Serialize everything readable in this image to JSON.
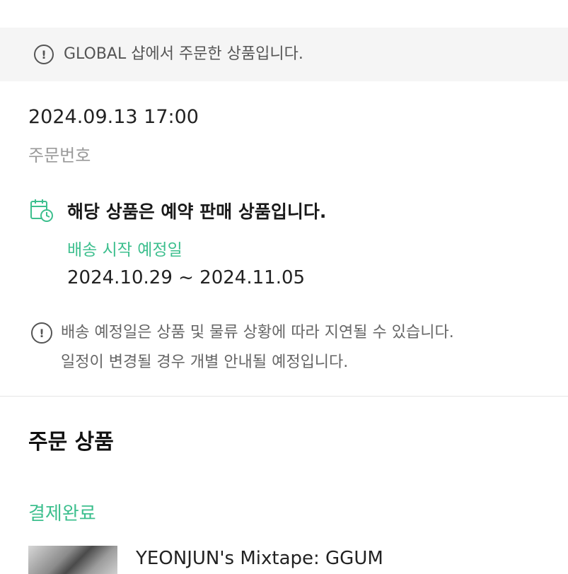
{
  "banner": {
    "icon": "info-icon",
    "text": "GLOBAL 샵에서 주문한 상품입니다."
  },
  "order": {
    "datetime": "2024.09.13 17:00",
    "order_number_label": "주문번호"
  },
  "presale": {
    "icon": "calendar-clock-icon",
    "title": "해당 상품은 예약 판매 상품입니다.",
    "ship_label": "배송 시작 예정일",
    "ship_range": "2024.10.29 ~ 2024.11.05"
  },
  "notice": {
    "icon": "info-icon",
    "line1": "배송 예정일은 상품 및 물류 상황에 따라 지연될 수 있습니다.",
    "line2": "일정이 변경될 경우 개별 안내될 예정입니다."
  },
  "products_section": {
    "title": "주문 상품",
    "status": "결제완료",
    "items": [
      {
        "name": "YEONJUN's Mixtape: GGUM"
      }
    ]
  },
  "colors": {
    "accent_green": "#3dbf8e",
    "banner_bg": "#f5f5f5"
  }
}
